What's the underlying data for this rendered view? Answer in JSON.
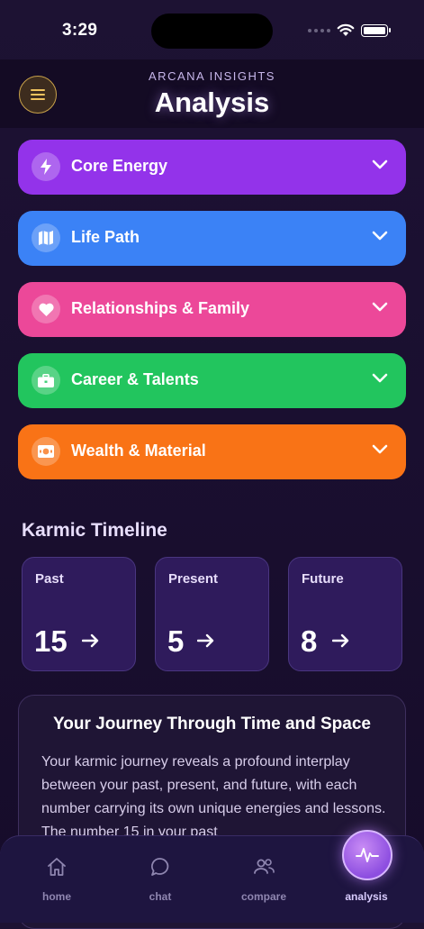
{
  "status_bar": {
    "time": "3:29"
  },
  "header": {
    "subtitle": "ARCANA INSIGHTS",
    "title": "Analysis"
  },
  "sections": [
    {
      "label": "Core Energy",
      "icon": "lightning-icon",
      "color": "#9333ea"
    },
    {
      "label": "Life Path",
      "icon": "map-icon",
      "color": "#3b82f6"
    },
    {
      "label": "Relationships & Family",
      "icon": "heart-icon",
      "color": "#ec4899"
    },
    {
      "label": "Career & Talents",
      "icon": "briefcase-icon",
      "color": "#22c55e"
    },
    {
      "label": "Wealth & Material",
      "icon": "money-icon",
      "color": "#f97316"
    }
  ],
  "karmic_timeline": {
    "title": "Karmic Timeline",
    "cards": [
      {
        "label": "Past",
        "value": "15"
      },
      {
        "label": "Present",
        "value": "5"
      },
      {
        "label": "Future",
        "value": "8"
      }
    ]
  },
  "journey": {
    "title": "Your Journey Through Time and Space",
    "text": "Your karmic journey reveals a profound interplay between your past, present, and future, with each number carrying its own unique energies and lessons. The number 15 in your past"
  },
  "tabs": [
    {
      "label": "home",
      "icon": "home-icon"
    },
    {
      "label": "chat",
      "icon": "chat-bubble-icon"
    },
    {
      "label": "compare",
      "icon": "users-icon"
    },
    {
      "label": "analysis",
      "icon": "pulse-icon",
      "active": true
    }
  ]
}
